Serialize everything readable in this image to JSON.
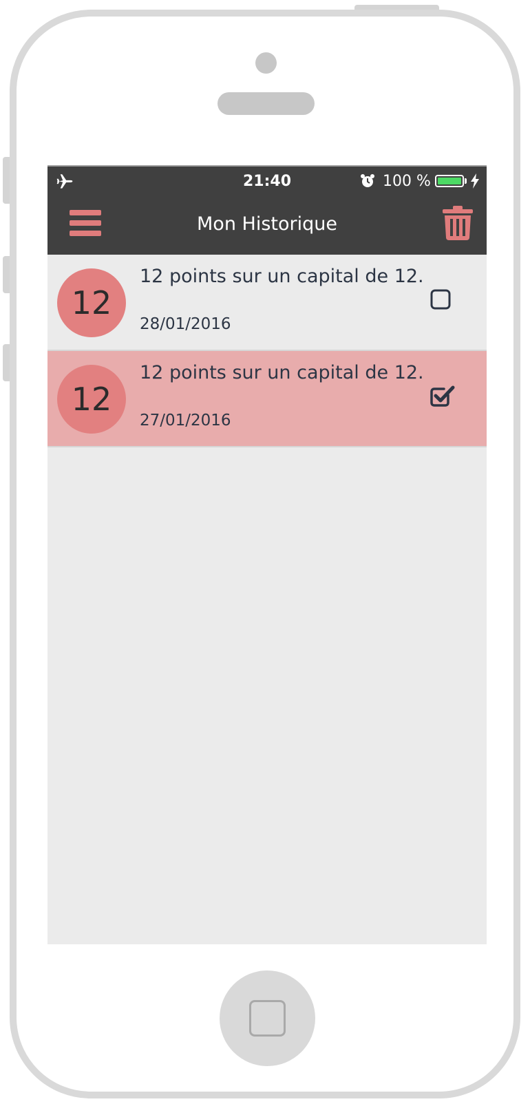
{
  "status_bar": {
    "time": "21:40",
    "battery_percent": "100 %",
    "icons": [
      "airplane-icon",
      "alarm-icon",
      "battery-icon",
      "charging-bolt-icon"
    ]
  },
  "nav": {
    "title": "Mon Historique",
    "left_icon": "menu-icon",
    "right_icon": "trash-icon"
  },
  "history": [
    {
      "score": "12",
      "title": "12 points sur un capital de 12.",
      "date": "28/01/2016",
      "checked": false
    },
    {
      "score": "12",
      "title": "12 points sur un capital de 12.",
      "date": "27/01/2016",
      "checked": true
    }
  ],
  "colors": {
    "bar": "#404040",
    "accent": "#e07c7c",
    "badge": "#e28080",
    "selected_row": "#e8acac",
    "background": "#ebebeb",
    "text": "#2c3544",
    "battery": "#4cd964"
  }
}
